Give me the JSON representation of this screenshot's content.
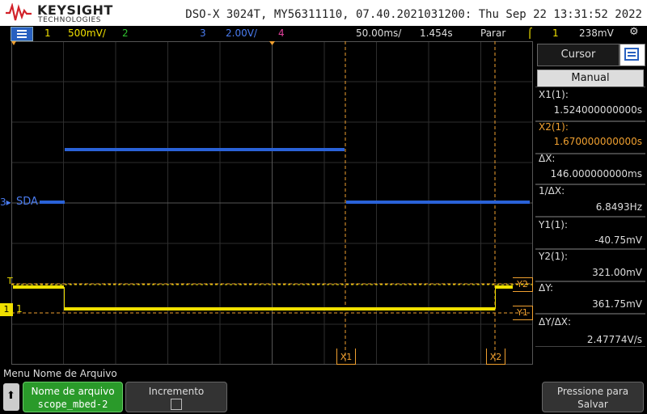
{
  "header": {
    "brand": "KEYSIGHT",
    "brand_sub": "TECHNOLOGIES",
    "title": "DSO-X 3024T, MY56311110, 07.40.2021031200: Thu Sep 22 13:31:52 2022"
  },
  "status_bar": {
    "ch1_num": "1",
    "ch1_scale": "500mV/",
    "ch2_num": "2",
    "ch3_num": "3",
    "ch3_scale": "2.00V/",
    "ch4_num": "4",
    "timebase": "50.00ms/",
    "delay": "1.454s",
    "run_state": "Parar",
    "trigger_ch": "1",
    "trigger_level": "238mV"
  },
  "waveform_labels": {
    "ch3_marker": "3",
    "sda_label": "SDA",
    "trigger_marker": "T",
    "ch1_marker": "1",
    "ch1_label": "1",
    "y1_marker": "Y1",
    "y2_marker": "Y2",
    "x1_marker": "X1",
    "x2_marker": "X2"
  },
  "sidebar": {
    "tab_label": "Cursor",
    "mode": "Manual",
    "x1_label": "X1(1):",
    "x1_value": "1.524000000000s",
    "x2_label": "X2(1):",
    "x2_value": "1.670000000000s",
    "dx_label": "ΔX:",
    "dx_value": "146.000000000ms",
    "inv_dx_label": "1/ΔX:",
    "inv_dx_value": "6.8493Hz",
    "y1_label": "Y1(1):",
    "y1_value": "-40.75mV",
    "y2_label": "Y2(1):",
    "y2_value": "321.00mV",
    "dy_label": "ΔY:",
    "dy_value": "361.75mV",
    "dydx_label": "ΔY/ΔX:",
    "dydx_value": "2.47774V/s"
  },
  "softkeys": {
    "menu_title": "Menu Nome de Arquivo",
    "filename_label": "Nome de arquivo",
    "filename_value": "scope_mbed-2",
    "increment_label": "Incremento",
    "save_label_1": "Pressione para",
    "save_label_2": "Salvar"
  },
  "colors": {
    "ch1": "#f0e000",
    "ch3": "#2a62d8",
    "cursor": "#f0a030",
    "softkey_green": "#2a9a2a"
  }
}
